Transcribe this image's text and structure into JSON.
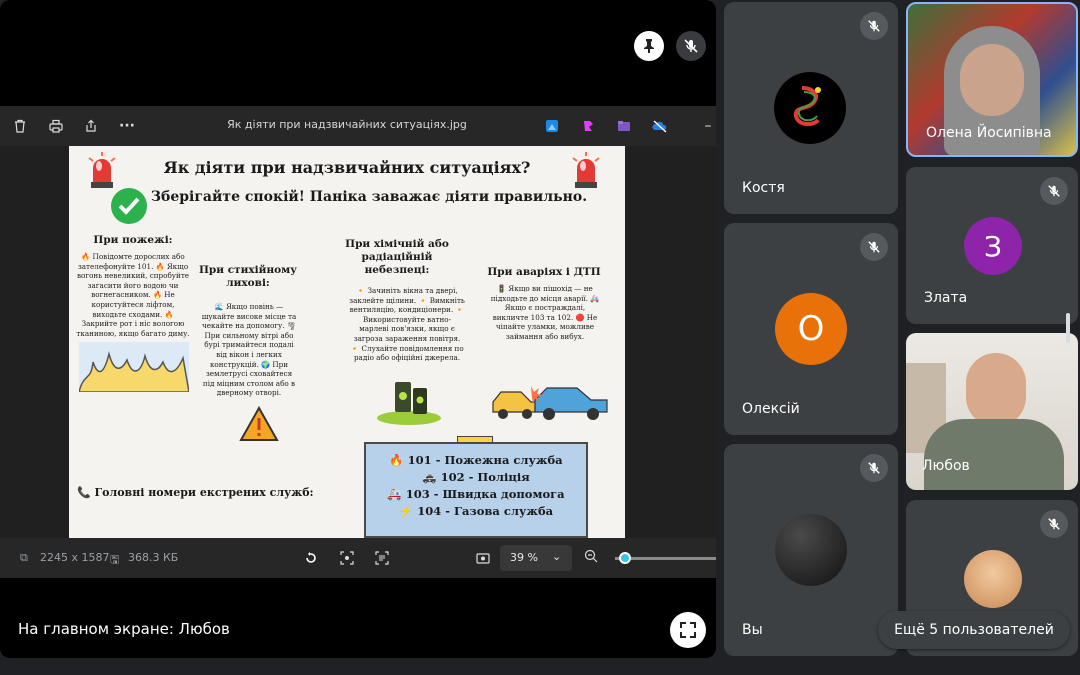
{
  "viewer": {
    "title": "Як діяти при надзвичайних ситуаціях.jpg",
    "dimensions": "2245 x 1587",
    "filesize": "368.3 КБ",
    "zoom": "39 %",
    "zoom_level": 0.05
  },
  "infographic": {
    "title": "Як діяти при надзвичайних ситуаціях?",
    "subtitle": "Зберігайте спокій! Паніка заважає діяти правильно.",
    "fire_heading": "При пожежі:",
    "fire_text": "🔥 Повідомте дорослих або зателефонуйте 101. 🔥 Якщо вогонь невеликий, спробуйте загасити його водою чи вогнегасником. 🔥 Не користуйтеся ліфтом, виходьте сходами. 🔥 Закрийте рот і ніс вологою тканиною, якщо багато диму.",
    "disaster_heading": "При стихійному лихові:",
    "disaster_text": "🌊 Якщо повінь — шукайте високе місце та чекайте на допомогу. 🌪 При сильному вітрі або бурі тримайтеся подалі від вікон і легких конструкцій. 🌍 При землетрусі сховайтеся під міцним столом або в дверному отворі.",
    "chem_heading": "При хімічній або радіаційній небезпеці:",
    "chem_text": "🔸 Зачиніть вікна та двері, заклейте щілини. 🔸 Вимкніть вентиляцію, кондиціонери. 🔸 Використовуйте ватно-марлеві пов'язки, якщо є загроза зараження повітря. 🔸 Слухайте повідомлення по радіо або офіційні джерела.",
    "accident_heading": "При аваріях і ДТП",
    "accident_text": "🚦 Якщо ви пішохід — не підходьте до місця аварії. 🚑 Якщо є постраждалі, викличте 103 та 102. 🔴 Не чіпайте уламки, можливе займання або вибух.",
    "numbers_label": "📞 Головні номери екстрених служб:",
    "numbers": [
      "🔥 101 - Пожежна служба",
      "🚓 102 - Поліція",
      "🚑 103 - Швидка допомога",
      "⚡ 104 - Газова служба"
    ]
  },
  "presenter": {
    "label": "На главном экране: Любов"
  },
  "participants": [
    {
      "name": "Олена Йосипівна"
    },
    {
      "name": "Костя"
    },
    {
      "name": "Злата",
      "initial": "З",
      "color": "#8e24aa"
    },
    {
      "name": "Олексій",
      "initial": "О",
      "color": "#e8710a"
    },
    {
      "name": "Любов"
    },
    {
      "name": "Вы"
    }
  ],
  "more_users": "Ещё 5 пользователей"
}
